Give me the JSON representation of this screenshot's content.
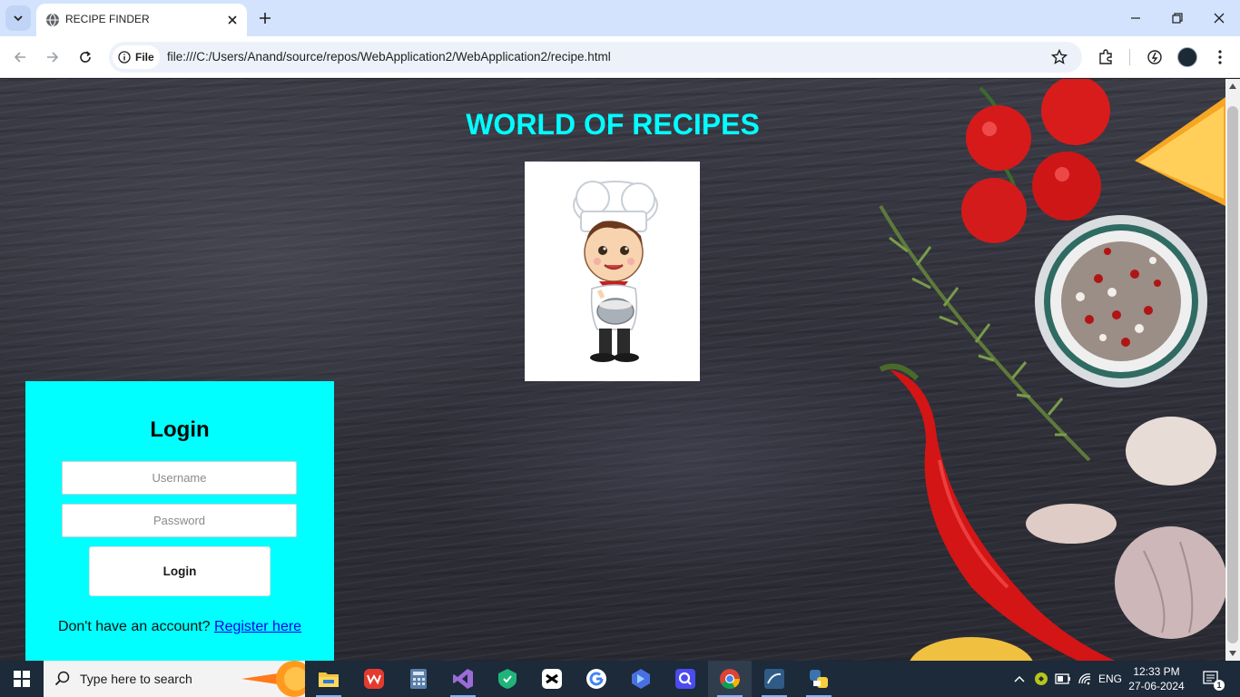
{
  "browser": {
    "tab_title": "RECIPE FINDER",
    "url_chip": "File",
    "url": "file:///C:/Users/Anand/source/repos/WebApplication2/WebApplication2/recipe.html"
  },
  "page": {
    "title": "WORLD OF RECIPES",
    "login": {
      "heading": "Login",
      "username_placeholder": "Username",
      "password_placeholder": "Password",
      "button_label": "Login",
      "register_prompt": "Don't have an account?",
      "register_link": "Register here"
    }
  },
  "taskbar": {
    "search_placeholder": "Type here to search",
    "apps": [
      "file-explorer",
      "wps-office",
      "calculator",
      "visual-studio",
      "kaspersky",
      "capcut",
      "google",
      "bing",
      "quick-assist",
      "chrome",
      "mysql-workbench",
      "python"
    ],
    "language": "ENG",
    "time": "12:33 PM",
    "date": "27-06-2024",
    "notification_count": "1"
  },
  "colors": {
    "accent_cyan": "#00ffff",
    "tab_strip": "#d3e3fd",
    "taskbar": "#1c2a3a",
    "link": "#0000ee"
  }
}
